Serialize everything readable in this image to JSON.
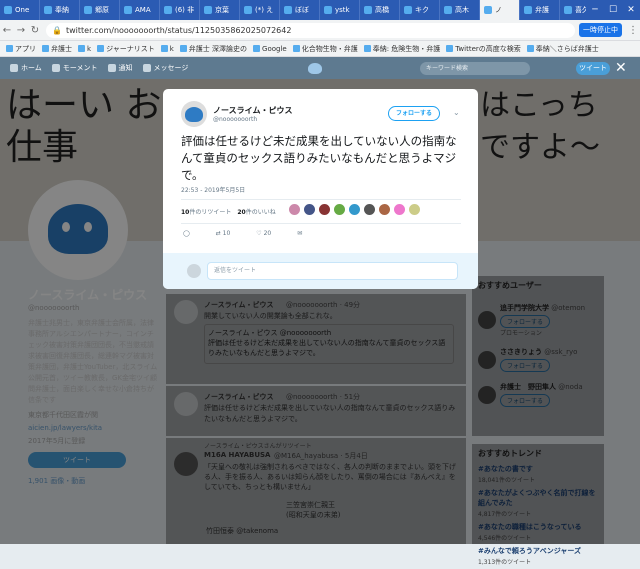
{
  "browser": {
    "tabs": [
      "One",
      "奉納",
      "郷原",
      "AMA",
      "(6) 非",
      "京葉",
      "(*) え",
      "ぼぼ",
      "ystk",
      "高橋",
      "キク",
      "高木",
      "ノ",
      "弁護",
      "喜久"
    ],
    "url": "twitter.com/nooooooorth/status/1125035862025072642",
    "update_chip": "一時停止中",
    "bookmarks": [
      "アプリ",
      "弁護士",
      "k",
      "ジャーナリスト",
      "k",
      "弁護士 深澤論史の",
      "Google",
      "化合物生物・弁護",
      "奉納: 危険生物・弁護",
      "Twitterの高度な検索",
      "奉納＼さらば弁護士"
    ],
    "window_buttons": [
      "─",
      "☐",
      "✕"
    ]
  },
  "twitter_nav": {
    "home": "ホーム",
    "moments": "モーメント",
    "notifications": "通知",
    "messages": "メッセージ",
    "search_placeholder": "キーワード検索",
    "tweet_button": "ツイート"
  },
  "banner": {
    "left_text": "はーい お仕事",
    "right_text": "はこっち ですよ〜"
  },
  "profile": {
    "name": "ノースライム・ピウス",
    "handle": "@nooooooorth",
    "bio": "弁護士兆男士，東京弁護士会所属，法律事務所アルシエンパートナー，コインチェック被害対策弁護団団長，不当懲戒請求被害回復弁護団長，総連幹マグ被害対策弁護団，弁護士YouTuber，北スライム公開元首，ツイー教教長，GK金宅ツイ顧問弁護士，面白楽しく幸せな小倉持ちが信条です",
    "location": "東京都千代田区霞が関",
    "link": "aicien.jp/lawyers/kita",
    "joined": "2017年5月に登録",
    "tweet_button": "ツイート",
    "media": "1,901 画像・動画"
  },
  "modal": {
    "author_name": "ノースライム・ピウス",
    "author_handle": "@nooooooorth",
    "follow_label": "フォローする",
    "text": "評価は任せるけど未だ成果を出していない人の指南なんて童貞のセックス語りみたいなもんだと思うよマジで。",
    "timestamp": "22:53 - 2019年5月5日",
    "retweets": "10",
    "retweets_label": "件のリツイート",
    "likes": "20",
    "likes_label": "件のいいね",
    "action_retweets": "10",
    "action_likes": "20",
    "reply_placeholder": "返信をツイート"
  },
  "timeline": [
    {
      "name": "ノースライム・ピウス",
      "handle": "@nooooooorth · 49分",
      "text": "開業していない人の開業論も全部これな。",
      "quote": "評価は任せるけど未だ成果を出していない人の指南なんて童貞のセックス語りみたいなもんだと思うよマジで。"
    },
    {
      "name": "ノースライム・ピウス",
      "handle": "@nooooooorth · 51分",
      "text": "評価は任せるけど未だ成果を出していない人の指南なんて童貞のセックス語りみたいなもんだと思うよマジで。"
    },
    {
      "rt": "ノースライム・ピウスさんがリツイート",
      "name": "M16A HAYABUSA",
      "handle": "@M16A_hayabusa · 5月4日",
      "text": "「天皇への敬礼は強制されるべきではなく、各人の判断のままでよい。頭を下げる人、手を振る人、あるいは知らん顔をしたり、罵倒の場合には『あんべえ』をしていても、ちっとも構いません」",
      "sub1": "三笠宮崇仁親王",
      "sub2": "(昭和天皇の末弟)",
      "footer": "竹田恒泰 @takenoma"
    }
  ],
  "recommend": {
    "title": "おすすめユーザー",
    "users": [
      {
        "name": "追手門学院大学",
        "handle": "@otemon",
        "follow": "フォローする",
        "tag": "プロモーション"
      },
      {
        "name": "ささきりょう",
        "handle": "@ssk_ryo",
        "follow": "フォローする"
      },
      {
        "name": "弁護士　野田隼人",
        "handle": "@noda",
        "follow": "フォローする"
      }
    ]
  },
  "trends": {
    "title": "おすすめトレンド",
    "items": [
      {
        "tag": "#あなたの書です",
        "count": "18,041件のツイート"
      },
      {
        "tag": "#あなたがよくつぶやく名前で打線を組んでみた",
        "count": "4,817件のツイート"
      },
      {
        "tag": "#あなたの職種はこうなっている",
        "count": "4,546件のツイート"
      },
      {
        "tag": "#みんなで頼ろうアベンジャーズ",
        "count": "1,313件のツイート"
      }
    ]
  }
}
